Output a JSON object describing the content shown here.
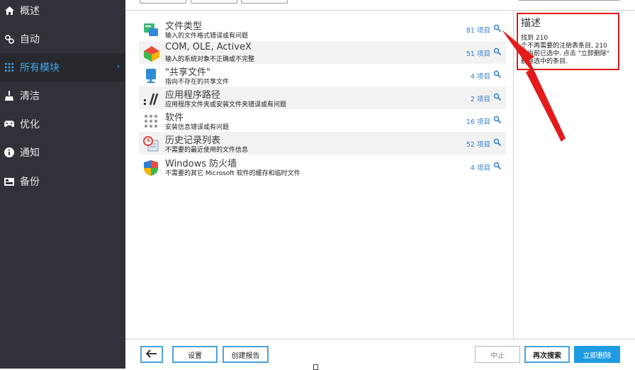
{
  "sidebar": {
    "items": [
      {
        "label": "概述",
        "icon": "home-icon"
      },
      {
        "label": "自动",
        "icon": "automation-icon"
      },
      {
        "label": "所有模块",
        "icon": "grid-icon",
        "active": true
      },
      {
        "label": "清洁",
        "icon": "broom-icon"
      },
      {
        "label": "优化",
        "icon": "gamepad-icon"
      },
      {
        "label": "通知",
        "icon": "info-icon"
      },
      {
        "label": "备份",
        "icon": "backup-icon"
      }
    ]
  },
  "results": [
    {
      "title": "文件类型",
      "desc": "输入的文件格式错误或有问题",
      "count": "81 项目",
      "icon": "file-types-icon"
    },
    {
      "title": "COM, OLE, ActiveX",
      "desc": "输入的系统对象不正确或不完整",
      "count": "51 项目",
      "icon": "com-ole-icon"
    },
    {
      "title": "\"共享文件\"",
      "desc": "指向不存在的共享文件",
      "count": "4 项目",
      "icon": "shared-files-icon"
    },
    {
      "title": "应用程序路径",
      "desc": "应用程序文件夹或安装文件夹错误或有问题",
      "count": "2 项目",
      "icon": "app-paths-icon"
    },
    {
      "title": "软件",
      "desc": "安装信息错误或有问题",
      "count": "16 项目",
      "icon": "software-icon"
    },
    {
      "title": "历史记录列表",
      "desc": "不需要的最近使用的文件信息",
      "count": "52 项目",
      "icon": "history-list-icon"
    },
    {
      "title": "Windows 防火墙",
      "desc": "不需要的其它 Microsoft 软件的缓存和临时文件",
      "count": "4 项目",
      "icon": "firewall-shield-icon"
    }
  ],
  "description": {
    "title": "描述",
    "line1": "找到 210",
    "line2": "个不再需要的注册表条目, 210",
    "line3": "个当前已选中. 点击 \"立即删除\"",
    "line4": "删除选中的条目."
  },
  "footer": {
    "back_icon": "arrow-left-icon",
    "settings": "设置",
    "create_report": "创建报告",
    "stop": "中止",
    "rescan": "再次搜索",
    "delete_now": "立即删除"
  },
  "colors": {
    "sidebar_bg": "#2f3238",
    "accent_blue": "#41a5e8",
    "count_blue": "#2f7fd0",
    "highlight_red": "#e21b1b",
    "primary_button": "#1e9be2"
  }
}
